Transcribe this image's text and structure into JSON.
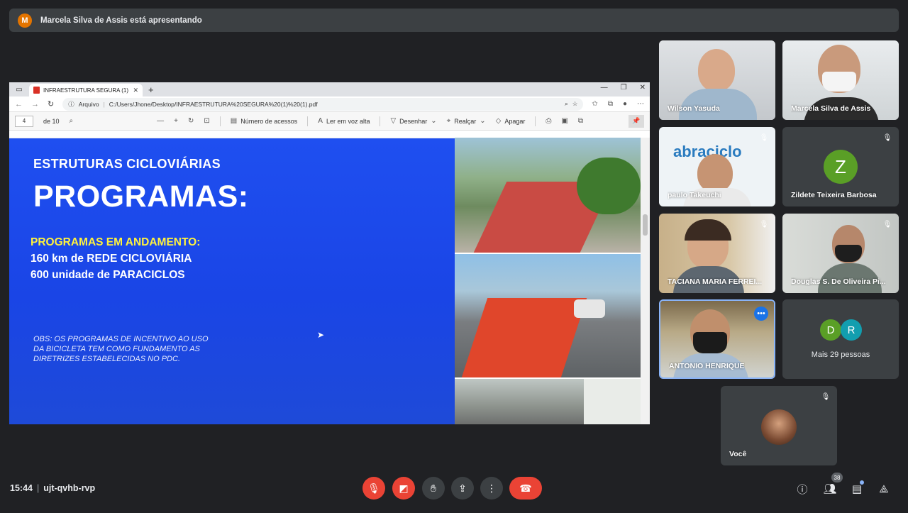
{
  "banner": {
    "initial": "M",
    "text": "Marcela Silva de Assis está apresentando"
  },
  "browser": {
    "tab_title": "INFRAESTRUTURA SEGURA (1) (",
    "address_label": "Arquivo",
    "url": "C:/Users/Jhone/Desktop/INFRAESTRUTURA%20SEGURA%20(1)%20(1).pdf",
    "toolbar": {
      "page_current": "4",
      "page_total": "de 10",
      "access_numbers": "Número de acessos",
      "read_aloud": "Ler em voz alta",
      "draw": "Desenhar",
      "highlight": "Realçar",
      "erase": "Apagar"
    }
  },
  "slide": {
    "kicker": "ESTRUTURAS CICLOVIÁRIAS",
    "title": "PROGRAMAS:",
    "subtitle": "PROGRAMAS EM ANDAMENTO:",
    "line1": "160 km de REDE CICLOVIÁRIA",
    "line2": "600 unidade de PARACICLOS",
    "obs": "OBS: OS PROGRAMAS DE INCENTIVO AO USO DA BICICLETA TEM COMO FUNDAMENTO AS DIRETRIZES ESTABELECIDAS NO PDC."
  },
  "participants": {
    "p1": "Wilson Yasuda",
    "p2": "Marcela Silva de Assis",
    "p3": "paulo Takeuchi",
    "p3_banner": "abraciclo",
    "p4": "Zildete Teixeira Barbosa",
    "p4_initial": "Z",
    "p5": "TACIANA MARIA FERREI...",
    "p6": "Douglas S. De Oliveira Pi...",
    "p7": "ANTONIO HENRIQUE",
    "more_initials": [
      "D",
      "R"
    ],
    "more_label": "Mais 29 pessoas",
    "self": "Você"
  },
  "bottom": {
    "time": "15:44",
    "meeting_code": "ujt-qvhb-rvp",
    "participant_count": "38"
  },
  "colors": {
    "accent": "#1a73e8",
    "danger": "#ea4335",
    "slide_blue": "#1f4ff0",
    "highlight_yellow": "#fff23d"
  }
}
